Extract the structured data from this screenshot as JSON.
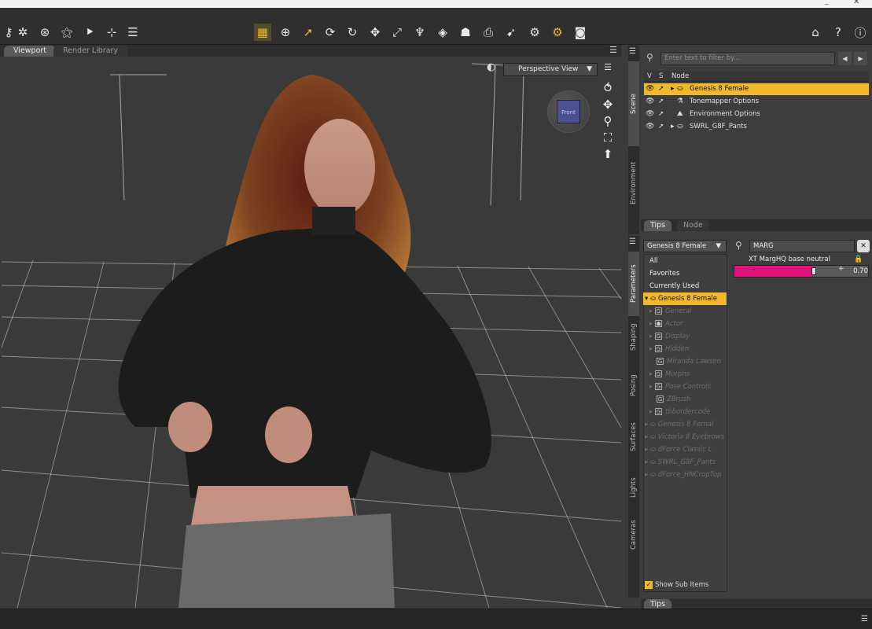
{
  "viewport_tabs": {
    "viewport": "Viewport",
    "render_library": "Render Library"
  },
  "viewport": {
    "view_mode": "Perspective View",
    "cube_face": "Front"
  },
  "scene": {
    "side_tabs": [
      "Scene",
      "Environment"
    ],
    "filter_placeholder": "Enter text to filter by...",
    "col_v": "V",
    "col_s": "S",
    "col_node": "Node",
    "items": [
      {
        "label": "Genesis 8 Female",
        "selected": true
      },
      {
        "label": "Tonemapper Options"
      },
      {
        "label": "Environment Options"
      },
      {
        "label": "SWRL_G8F_Pants"
      }
    ],
    "bottom_tabs": {
      "tips": "Tips",
      "node": "Node"
    }
  },
  "parameters": {
    "side_tabs": [
      "Parameters",
      "Shaping",
      "Posing",
      "Surfaces",
      "Lights",
      "Cameras"
    ],
    "node_select": "Genesis 8 Female",
    "tree": [
      {
        "label": "All"
      },
      {
        "label": "Favorites"
      },
      {
        "label": "Currently Used"
      },
      {
        "label": "Genesis 8 Female",
        "selected": true
      },
      {
        "label": "General",
        "dim": true
      },
      {
        "label": "Actor",
        "dim": true
      },
      {
        "label": "Display",
        "dim": true
      },
      {
        "label": "Hidden",
        "dim": true
      },
      {
        "label": "Miranda Lawson",
        "dim": true
      },
      {
        "label": "Morphs",
        "dim": true
      },
      {
        "label": "Pose Controls",
        "dim": true
      },
      {
        "label": "ZBrush",
        "dim": true
      },
      {
        "label": "tbbordercode",
        "dim": true
      },
      {
        "label": "Genesis 8 Femal",
        "dim": true
      },
      {
        "label": "Victoria 8 Eyebrows",
        "dim": true
      },
      {
        "label": "dForce Classic L",
        "dim": true
      },
      {
        "label": "SWRL_G8F_Pants",
        "dim": true
      },
      {
        "label": "dForce_HNCropTop",
        "dim": true
      }
    ],
    "search_value": "MARG",
    "slider": {
      "label": "XT MargHQ base neutral",
      "value_text": "0.70",
      "value": 0.7
    },
    "show_sub_items": "Show Sub Items",
    "tips_tab": "Tips"
  },
  "colors": {
    "accent": "#f2b82b",
    "slider": "#e0147e"
  }
}
